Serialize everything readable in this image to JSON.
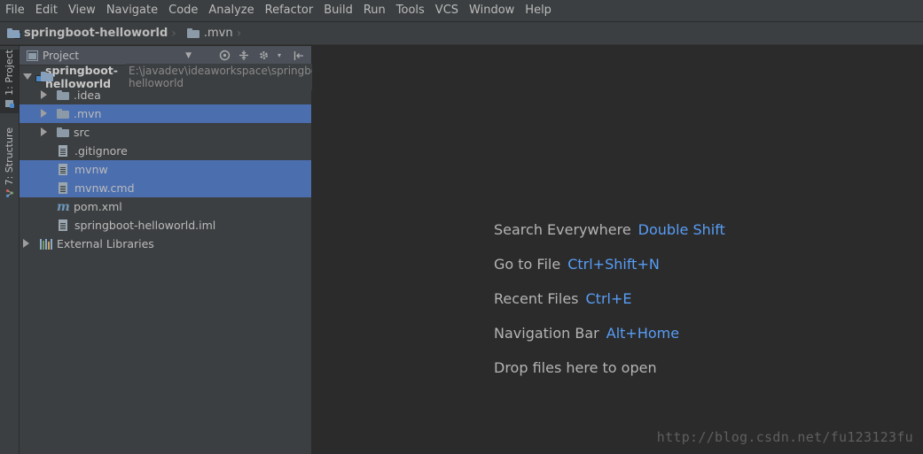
{
  "menu": [
    "File",
    "Edit",
    "View",
    "Navigate",
    "Code",
    "Analyze",
    "Refactor",
    "Build",
    "Run",
    "Tools",
    "VCS",
    "Window",
    "Help"
  ],
  "navbar": {
    "project": "springboot-helloworld",
    "folder": ".mvn"
  },
  "toolstrip": {
    "project_tab": "1: Project",
    "structure_tab": "7: Structure"
  },
  "panel": {
    "title": "Project",
    "tools": [
      "locate-icon",
      "collapse-icon",
      "settings-icon",
      "hide-icon"
    ]
  },
  "tree": {
    "root": {
      "name": "springboot-helloworld",
      "path": "E:\\javadev\\ideaworkspace\\springboot_idea_work\\springboot-helloworld"
    },
    "items": [
      {
        "name": ".idea",
        "icon": "folder-icon",
        "selected": false
      },
      {
        "name": ".mvn",
        "icon": "folder-icon",
        "selected": true
      },
      {
        "name": "src",
        "icon": "folder-icon",
        "selected": false
      },
      {
        "name": ".gitignore",
        "icon": "file-icon",
        "selected": false
      },
      {
        "name": "mvnw",
        "icon": "file-icon",
        "selected": true
      },
      {
        "name": "mvnw.cmd",
        "icon": "file-icon",
        "selected": true
      },
      {
        "name": "pom.xml",
        "icon": "maven-icon",
        "selected": false
      },
      {
        "name": "springboot-helloworld.iml",
        "icon": "module-file-icon",
        "selected": false
      }
    ],
    "external": "External Libraries"
  },
  "editor": {
    "hints": [
      {
        "name": "Search Everywhere",
        "key": "Double Shift"
      },
      {
        "name": "Go to File",
        "key": "Ctrl+Shift+N"
      },
      {
        "name": "Recent Files",
        "key": "Ctrl+E"
      },
      {
        "name": "Navigation Bar",
        "key": "Alt+Home"
      },
      {
        "name": "Drop files here to open",
        "key": ""
      }
    ],
    "watermark": "http://blog.csdn.net/fu123123fu"
  },
  "colors": {
    "background": "#2b2b2b",
    "panel": "#3c3f41",
    "selection": "#4b6eaf",
    "key_accent": "#589df6"
  }
}
